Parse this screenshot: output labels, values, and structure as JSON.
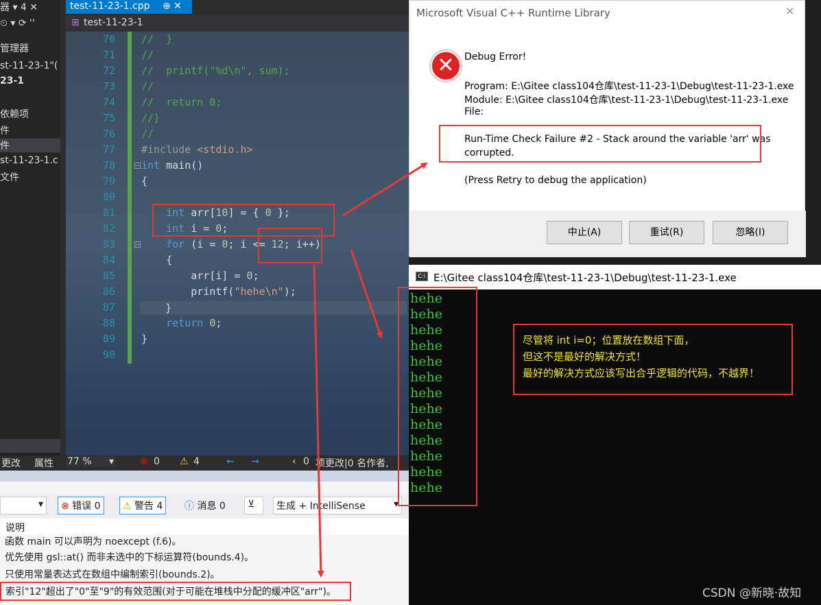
{
  "sidebar": {
    "rows": [
      "器  ▾ 4 ✕",
      "⏲ ▾ ⟳ ''",
      "管理器",
      "st-11-23-1\"(",
      "23-1",
      "依赖项",
      "件",
      "件",
      "st-11-23-1.c",
      "文件"
    ]
  },
  "editor": {
    "tab_label": "test-11-23-1.cpp",
    "tab_pin": "⊕ ✕",
    "nav_scope": "test-11-23-1",
    "line_numbers": [
      "70",
      "71",
      "72",
      "73",
      "74",
      "75",
      "76",
      "77",
      "78",
      "79",
      "80",
      "81",
      "82",
      "83",
      "84",
      "85",
      "86",
      "87",
      "88",
      "89",
      "90"
    ]
  },
  "statusbar": {
    "changes": "更改",
    "properties": "属性",
    "zoom": "77 %",
    "errors": "0",
    "warnings": "4",
    "changes_count": "0",
    "git_text": "项更改|0 名作者,"
  },
  "error_list": {
    "errors_btn": "错误 0",
    "warnings_btn": "警告 4",
    "messages_btn": "消息 0",
    "source": "生成 + IntelliSense",
    "header": "说明",
    "rows": [
      "函数 main 可以声明为 noexcept (f.6)。",
      "优先使用 gsl::at() 而非未选中的下标运算符(bounds.4)。",
      "只使用常量表达式在数组中编制索引(bounds.2)。",
      "索引\"12\"超出了\"0\"至\"9\"的有效范围(对于可能在堆栈中分配的缓冲区\"arr\")。"
    ]
  },
  "dialog": {
    "title": "Microsoft Visual C++ Runtime Library",
    "close": "✕",
    "heading": "Debug Error!",
    "program": "Program: E:\\Gitee class104仓库\\test-11-23-1\\Debug\\test-11-23-1.exe",
    "module": "Module: E:\\Gitee class104仓库\\test-11-23-1\\Debug\\test-11-23-1.exe",
    "file": "File:",
    "failure_line1": "Run-Time Check Failure #2 - Stack around the variable 'arr' was",
    "failure_line2": "corrupted.",
    "hint": "(Press Retry to debug the application)",
    "btn_abort": "中止(A)",
    "btn_retry": "重试(R)",
    "btn_ignore": "忽略(I)"
  },
  "console": {
    "title": "E:\\Gitee class104仓库\\test-11-23-1\\Debug\\test-11-23-1.exe",
    "icon": "C:\\",
    "lines": [
      "hehe",
      "hehe",
      "hehe",
      "hehe",
      "hehe",
      "hehe",
      "hehe",
      "hehe",
      "hehe",
      "hehe",
      "hehe",
      "hehe",
      "hehe"
    ]
  },
  "annotation": {
    "line1": "尽管将 int i=0；位置放在数组下面，",
    "line2": "但这不是最好的解决方式！",
    "line3": "最好的解决方式应该写出合乎逻辑的代码，不越界！"
  },
  "watermark": "CSDN @新晓·故知",
  "colors": {
    "accent": "#007acc",
    "annotation_red": "#e53935",
    "console_green": "#3cc33c",
    "note_yellow": "#f3e52a"
  }
}
